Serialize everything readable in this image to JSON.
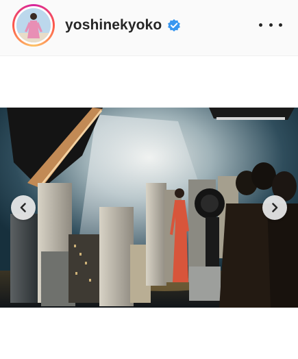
{
  "post": {
    "username": "yoshinekyoko",
    "verified": true,
    "more_icon": "more-horizontal-icon",
    "carousel": {
      "prev_icon": "chevron-left-icon",
      "next_icon": "chevron-right-icon"
    }
  },
  "colors": {
    "verified_badge": "#3897f0",
    "text": "#262626",
    "header_bg": "#fafafa"
  }
}
